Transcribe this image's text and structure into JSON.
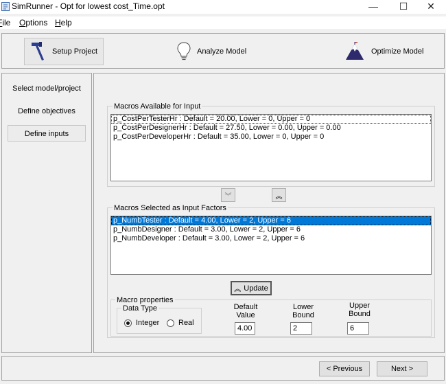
{
  "window": {
    "title": "SimRunner - Opt for lowest cost_Time.opt",
    "controls": {
      "minimize": "—",
      "maximize": "☐",
      "close": "✕"
    }
  },
  "menu": [
    {
      "label": "File",
      "mnemonic": "F"
    },
    {
      "label": "Options",
      "mnemonic": "O"
    },
    {
      "label": "Help",
      "mnemonic": "H"
    }
  ],
  "toolbar": {
    "setup": {
      "label": "Setup Project",
      "icon": "hammer-icon",
      "active": true
    },
    "analyze": {
      "label": "Analyze Model",
      "icon": "lightbulb-icon"
    },
    "optimize": {
      "label": "Optimize Model",
      "icon": "mountain-flag-icon"
    }
  },
  "nav": [
    {
      "label": "Select model/project",
      "active": false
    },
    {
      "label": "Define objectives",
      "active": false
    },
    {
      "label": "Define inputs",
      "active": true
    }
  ],
  "available": {
    "title": "Macros Available for Input",
    "items": [
      "p_CostPerTesterHr : Default = 20.00, Lower = 0, Upper = 0",
      "p_CostPerDesignerHr : Default = 27.50, Lower = 0.00, Upper = 0.00",
      "p_CostPerDeveloperHr : Default = 35.00, Lower = 0, Upper = 0"
    ]
  },
  "move_buttons": {
    "down": "︾",
    "up": "︽"
  },
  "selected": {
    "title": "Macros Selected as Input Factors",
    "items": [
      "p_NumbTester : Default = 4.00, Lower = 2, Upper = 6",
      "p_NumbDesigner : Default = 3.00, Lower = 2, Upper = 6",
      "p_NumbDeveloper : Default = 3.00, Lower = 2, Upper = 6"
    ],
    "selected_index": 0
  },
  "update_button": {
    "label": "Update",
    "icon": "︽"
  },
  "properties": {
    "title": "Macro properties",
    "data_type": {
      "title": "Data Type",
      "options": [
        "Integer",
        "Real"
      ],
      "selected": "Integer"
    },
    "default_label": "Default\nValue",
    "lower_label": "Lower\nBound",
    "upper_label": "Upper\nBound",
    "default_value": "4.00",
    "lower_value": "2",
    "upper_value": "6"
  },
  "footer": {
    "previous": "< Previous",
    "next": "Next >"
  },
  "colors": {
    "selection": "#0078d7",
    "background": "#f0f0f0",
    "optimize_icon": "#2e2a6b",
    "hammer_icon": "#2c3e8f"
  }
}
